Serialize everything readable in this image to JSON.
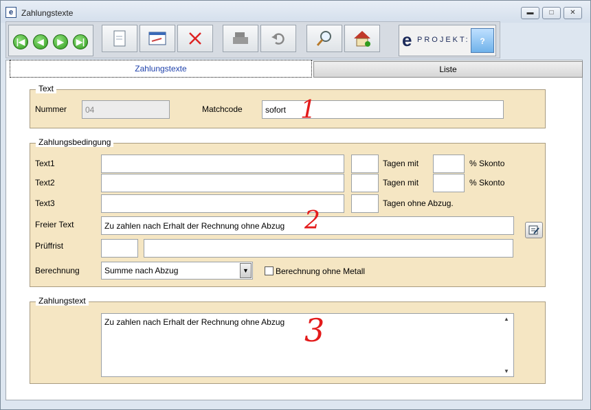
{
  "window": {
    "title": "Zahlungstexte",
    "app_icon": "e"
  },
  "toolbar": {
    "nav": [
      "first-record-icon",
      "previous-record-icon",
      "next-record-icon",
      "last-record-icon"
    ],
    "actions": [
      "new-document-icon",
      "edit-form-icon",
      "delete-icon",
      "print-icon",
      "undo-icon",
      "search-icon",
      "home-icon"
    ],
    "brand_e": "e",
    "brand_text": "PROJEKT:"
  },
  "tabs": [
    {
      "label": "Zahlungstexte"
    },
    {
      "label": "Liste"
    }
  ],
  "text_section": {
    "legend": "Text",
    "nummer_label": "Nummer",
    "nummer_value": "04",
    "matchcode_label": "Matchcode",
    "matchcode_value": "sofort"
  },
  "zahlungsbedingung": {
    "legend": "Zahlungsbedingung",
    "text1_label": "Text1",
    "text2_label": "Text2",
    "text3_label": "Text3",
    "tagen_mit_1": "Tagen mit",
    "tagen_mit_2": "Tagen mit",
    "tagen_ohne": "Tagen ohne Abzug.",
    "skonto_1": "% Skonto",
    "skonto_2": "% Skonto",
    "freier_text_label": "Freier Text",
    "freier_text_value": "Zu zahlen nach Erhalt der Rechnung ohne Abzug",
    "prueffrist_label": "Prüffrist",
    "berechnung_label": "Berechnung",
    "berechnung_value": "Summe nach Abzug",
    "checkbox_label": "Berechnung ohne Metall"
  },
  "zahlungstext": {
    "legend": "Zahlungstext",
    "value": "Zu zahlen nach Erhalt der Rechnung ohne Abzug"
  },
  "annotations": {
    "one": "1",
    "two": "2",
    "three": "3"
  }
}
